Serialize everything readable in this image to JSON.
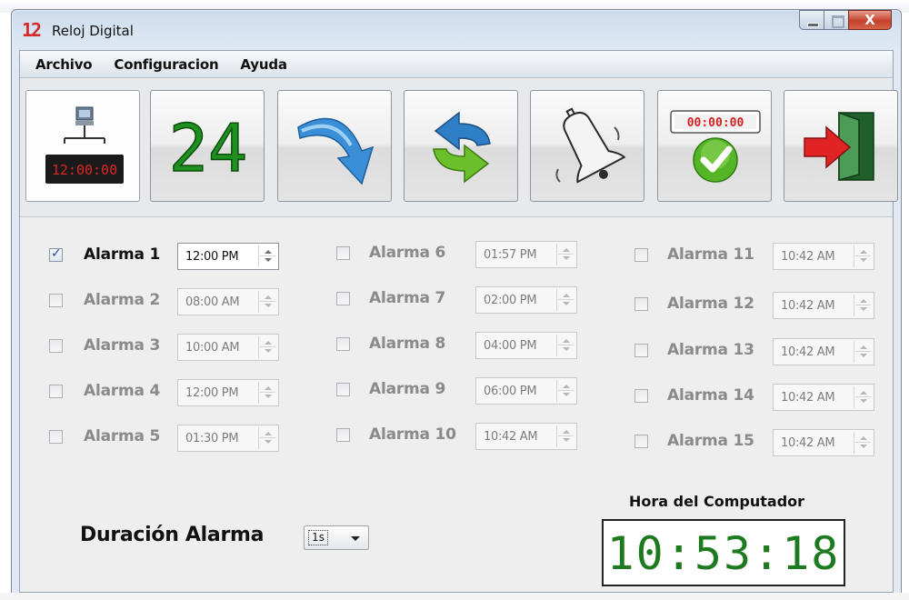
{
  "window": {
    "icon_text": "12",
    "title": "Reloj Digital",
    "close_glyph": "X"
  },
  "menu": [
    "Archivo",
    "Configuracion",
    "Ayuda"
  ],
  "toolbar": {
    "buttons": [
      {
        "name": "computer-clock",
        "text": "12:00:00"
      },
      {
        "name": "24-hour",
        "text": "24"
      },
      {
        "name": "redo-arrow"
      },
      {
        "name": "swap-arrows"
      },
      {
        "name": "bell"
      },
      {
        "name": "timer-check",
        "text": "00:00:00"
      },
      {
        "name": "exit-door"
      }
    ]
  },
  "alarms": [
    {
      "label": "Alarma 1",
      "time": "12:00 PM",
      "checked": true
    },
    {
      "label": "Alarma 2",
      "time": "08:00 AM",
      "checked": false
    },
    {
      "label": "Alarma 3",
      "time": "10:00 AM",
      "checked": false
    },
    {
      "label": "Alarma 4",
      "time": "12:00 PM",
      "checked": false
    },
    {
      "label": "Alarma 5",
      "time": "01:30 PM",
      "checked": false
    },
    {
      "label": "Alarma 6",
      "time": "01:57 PM",
      "checked": false
    },
    {
      "label": "Alarma 7",
      "time": "02:00 PM",
      "checked": false
    },
    {
      "label": "Alarma 8",
      "time": "04:00 PM",
      "checked": false
    },
    {
      "label": "Alarma 9",
      "time": "06:00 PM",
      "checked": false
    },
    {
      "label": "Alarma 10",
      "time": "10:42 AM",
      "checked": false
    },
    {
      "label": "Alarma 11",
      "time": "10:42 AM",
      "checked": false
    },
    {
      "label": "Alarma 12",
      "time": "10:42 AM",
      "checked": false
    },
    {
      "label": "Alarma 13",
      "time": "10:42 AM",
      "checked": false
    },
    {
      "label": "Alarma 14",
      "time": "10:42 AM",
      "checked": false
    },
    {
      "label": "Alarma 15",
      "time": "10:42 AM",
      "checked": false
    }
  ],
  "duration": {
    "label": "Duración Alarma",
    "value": "1s"
  },
  "computer_clock": {
    "title": "Hora del Computador",
    "time": "10:53:18"
  },
  "colors": {
    "digit_green": "#1e7a1e",
    "close_red": "#c4412b",
    "check_blue": "#2a47a8"
  }
}
